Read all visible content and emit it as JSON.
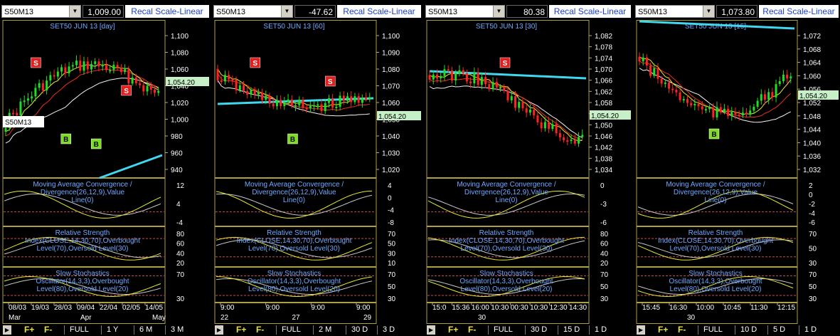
{
  "colors": {
    "axis_text": "#ffffff",
    "title_text": "#6fa8ff",
    "pane_border": "#b0a040",
    "price_tag_bg": "#c8f0c8",
    "up_candle": "#22dd22",
    "down_candle": "#ff2222",
    "ma_yellow": "#e8e832",
    "ma_red": "#e83020",
    "ma_white": "#f2f2f2",
    "ma_cyan": "#40d8f0",
    "signal_bg_sell": "#e51e1e",
    "signal_bg_buy": "#7ddc26",
    "ref_line": "#c05050",
    "macd_line": "#e8e832",
    "macd_signal": "#c8c8c8"
  },
  "panels": [
    {
      "symbol": "S50M13",
      "value": "1,009.00",
      "recal_label": "Recal Scale-Linear",
      "price_title": "SET50 JUN 13  [day]",
      "price_axis": [
        "1,100",
        "1,080",
        "1,060",
        "1,040",
        "1,020",
        "1,000",
        "980",
        "960",
        "940"
      ],
      "last_price": "1,054.20",
      "chart_label": "S50M13",
      "macd_title": "Moving Average Convergence / Divergence(26,12,9),Value Line(0)",
      "macd_axis": [
        "12",
        "4",
        "-4"
      ],
      "rsi_title": "Relative Strength Index(CLOSE,14,30,70),Overbought Level(70),Oversold Level(30)",
      "rsi_axis": [
        "80",
        "60",
        "40",
        "20"
      ],
      "sto_title": "Slow Stochastics Oscillator(14,3,3),Overbought Level(80),Oversold Level(20)",
      "sto_axis": [
        "70",
        "30"
      ],
      "date_axis": [
        "08/03",
        "19/03",
        "28/03",
        "09/04",
        "22/04",
        "02/05",
        "14/05"
      ],
      "date_axis2": [
        "Mar",
        "Apr",
        "May"
      ],
      "signals": [
        {
          "type": "S",
          "label": "S"
        },
        {
          "type": "B",
          "label": "B"
        },
        {
          "type": "B",
          "label": "B"
        },
        {
          "type": "S",
          "label": "S"
        }
      ],
      "ranges": [
        "FULL",
        "1 Y",
        "6 M",
        "3 M"
      ]
    },
    {
      "symbol": "S50M13",
      "value": "-47.62",
      "recal_label": "Recal Scale-Linear",
      "price_title": "SET50 JUN 13  [60]",
      "price_axis": [
        "1,100",
        "1,090",
        "1,080",
        "1,070",
        "1,060",
        "1,050",
        "1,040",
        "1,030",
        "1,020"
      ],
      "last_price": "1,054.20",
      "macd_title": "Moving Average Convergence / Divergence(26,12,9),Value Line(0)",
      "macd_axis": [
        "4",
        "0",
        "-4",
        "-8"
      ],
      "rsi_title": "Relative Strength Index(CLOSE,14,30,70),Overbought Level(70),Oversold Level(30)",
      "rsi_axis": [
        "70",
        "50",
        "30",
        "10"
      ],
      "sto_title": "Slow Stochastics Oscillator(14,3,3),Overbought Level(80),Oversold Level(20)",
      "sto_axis": [
        "70",
        "50",
        "30"
      ],
      "date_axis": [
        "9:00",
        "9:00",
        "9:00",
        "9:00"
      ],
      "date_axis2": [
        "22",
        "27",
        "29"
      ],
      "signals": [
        {
          "type": "S",
          "label": "S"
        },
        {
          "type": "B",
          "label": "B"
        },
        {
          "type": "S",
          "label": "S"
        }
      ],
      "ranges": [
        "FULL",
        "2 M",
        "30 D",
        "3 D"
      ]
    },
    {
      "symbol": "S50M13",
      "value": "80.38",
      "recal_label": "Recal Scale-Linear",
      "price_title": "SET50 JUN 13  [30]",
      "price_axis": [
        "1,082",
        "1,078",
        "1,074",
        "1,070",
        "1,066",
        "1,062",
        "1,058",
        "1,054",
        "1,050",
        "1,046",
        "1,042",
        "1,038",
        "1,034"
      ],
      "last_price": "1,054.20",
      "macd_title": "Moving Average Convergence / Divergence(26,12,9),Value Line(0)",
      "macd_axis": [
        "0",
        "-3",
        "-6"
      ],
      "rsi_title": "Relative Strength Index(CLOSE,14,30,70),Overbought Level(70),Oversold Level(30)",
      "rsi_axis": [
        "80",
        "60",
        "40",
        "20"
      ],
      "sto_title": "Slow Stochastics Oscillator(14,3,3),Overbought Level(80),Oversold Level(20)",
      "sto_axis": [
        "70",
        "50",
        "30"
      ],
      "date_axis": [
        "15:0",
        "15:36",
        "16:00",
        "10:30",
        "00:30",
        "10:30",
        "12:30",
        "14:30"
      ],
      "date_axis2": [
        "30"
      ],
      "signals": [
        {
          "type": "S",
          "label": "S"
        }
      ],
      "ranges": [
        "FULL",
        "30 D",
        "15 D",
        "1 D"
      ]
    },
    {
      "symbol": "S50M13",
      "value": "1,073.80",
      "recal_label": "Recal Scale-Linear",
      "price_title": "SET50 JUN 13  [15]",
      "price_axis": [
        "1,072",
        "1,068",
        "1,064",
        "1,060",
        "1,056",
        "1,052",
        "1,048",
        "1,044",
        "1,040",
        "1,036",
        "1,032"
      ],
      "last_price": "1,054.20",
      "macd_title": "Moving Average Convergence / Divergence(26,12,9),Value Line(0)",
      "macd_axis": [
        "2",
        "0",
        "-2",
        "-4",
        "-6"
      ],
      "rsi_title": "Relative Strength Index(CLOSE,14,30,70),Overbought Level(70),Oversold Level(30)",
      "rsi_axis": [
        "70",
        "50",
        "30"
      ],
      "sto_title": "Slow Stochastics Oscillator(14,3,3),Overbought Level(80),Oversold Level(20)",
      "sto_axis": [
        "70",
        "50",
        "30"
      ],
      "date_axis": [
        "15:45",
        "16:30",
        "10:00",
        "10:45",
        "11:30",
        "12:15"
      ],
      "date_axis2": [
        "30"
      ],
      "signals": [
        {
          "type": "B",
          "label": "B"
        }
      ],
      "ranges": [
        "FULL",
        "10 D",
        "5 D",
        "1 D"
      ]
    }
  ],
  "buttons": {
    "f_plus": "F+",
    "f_minus": "F-"
  }
}
